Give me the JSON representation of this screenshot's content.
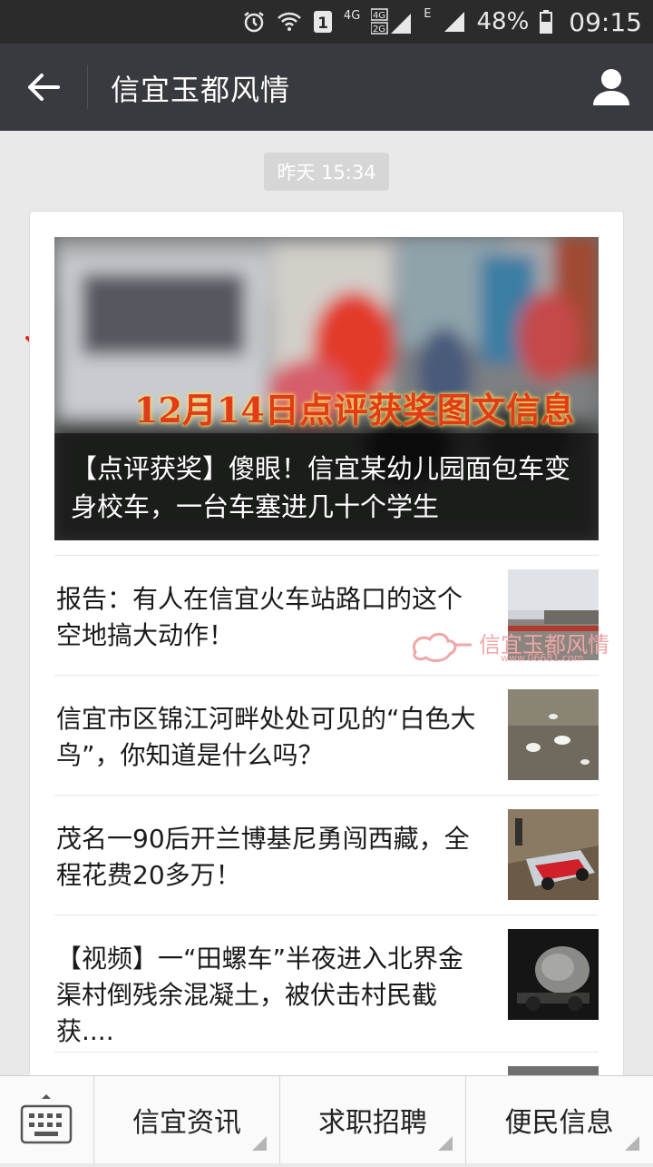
{
  "status_bar": {
    "network_1": "4G",
    "network_2_top": "4G",
    "network_2_bottom": "2G",
    "network_3": "E",
    "battery": "48%",
    "time": "09:15",
    "sim_badge": "1"
  },
  "header": {
    "title": "信宜玉都风情"
  },
  "message": {
    "timestamp": "昨天 15:34"
  },
  "hero": {
    "banner": "12月14日点评获奖图文信息",
    "title": "【点评获奖】傻眼！信宜某幼儿园面包车变身校车，一台车塞进几十个学生"
  },
  "articles": [
    {
      "title": "报告：有人在信宜火车站路口的这个空地搞大动作！",
      "watermark": "信宜玉都风情",
      "watermark_url": "www.06681.com"
    },
    {
      "title": "信宜市区锦江河畔处处可见的“白色大鸟”，你知道是什么吗？"
    },
    {
      "title": "茂名一90后开兰博基尼勇闯西藏，全程花费20多万！"
    },
    {
      "title": "【视频】一“田螺车”半夜进入北界金渠村倒残余混凝土，被伏击村民截获...."
    }
  ],
  "bottom_menu": [
    {
      "label": "信宜资讯"
    },
    {
      "label": "求职招聘"
    },
    {
      "label": "便民信息"
    }
  ],
  "colors": {
    "status_bar": "#2b2b2b",
    "nav_bar": "#393a3f",
    "background": "#e9e9e9",
    "banner_text": "#e23b1a"
  }
}
